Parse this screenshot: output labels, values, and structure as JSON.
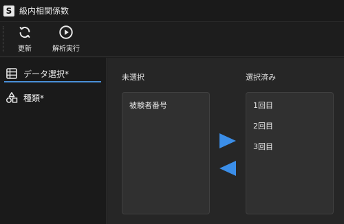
{
  "app": {
    "icon_letter": "S",
    "title": "級内相関係数"
  },
  "toolbar": {
    "refresh_label": "更新",
    "run_label": "解析実行"
  },
  "sidebar": {
    "items": [
      {
        "label": "データ選択*"
      },
      {
        "label": "種類*"
      }
    ]
  },
  "main": {
    "unselected_label": "未選択",
    "selected_label": "選択済み",
    "unselected_items": [
      "被験者番号"
    ],
    "selected_items": [
      "1回目",
      "2回目",
      "3回目"
    ]
  },
  "colors": {
    "accent": "#4a90d9",
    "arrow": "#3b8ee8"
  }
}
